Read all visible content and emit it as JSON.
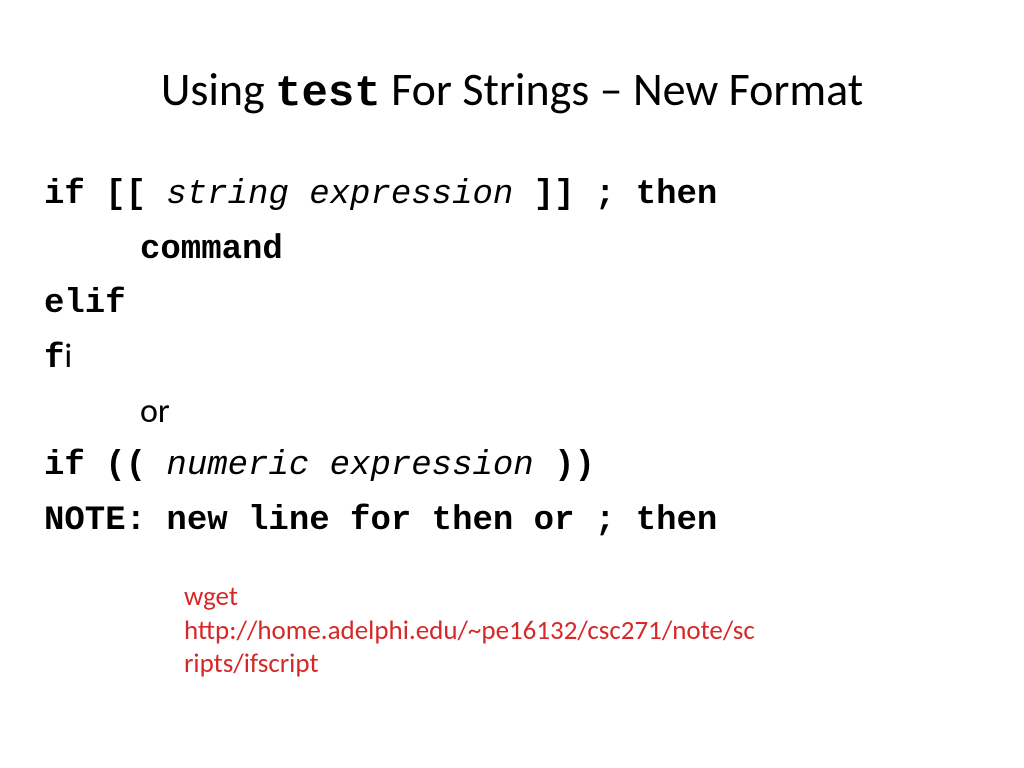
{
  "title": {
    "prefix": "Using ",
    "code": "test",
    "suffix": " For Strings – New Format"
  },
  "lines": {
    "l1_if": "if [[ ",
    "l1_expr": "string expression",
    "l1_tail": " ]]  ; then",
    "l2": "command",
    "l3": "elif",
    "l4_f": "f",
    "l4_i": "i",
    "l5": "or",
    "l6_if": "if (( ",
    "l6_expr": "numeric expression",
    "l6_tail": " ))",
    "l7": "NOTE: new line for then or ; then"
  },
  "link": {
    "line1": "wget",
    "line2": "http://home.adelphi.edu/~pe16132/csc271/note/sc",
    "line3": "ripts/ifscript"
  }
}
